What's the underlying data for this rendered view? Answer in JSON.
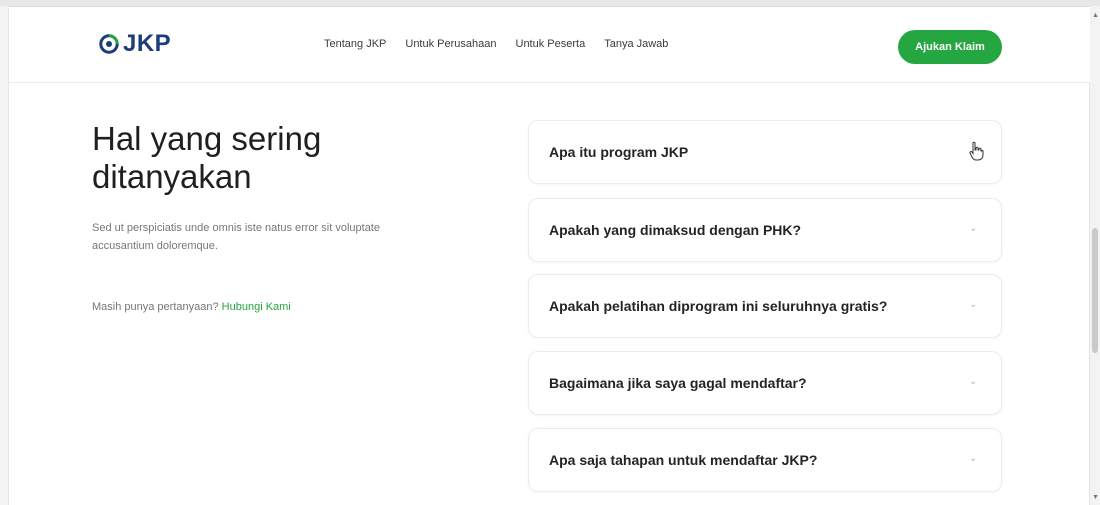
{
  "header": {
    "brand": "JKP",
    "nav": [
      "Tentang JKP",
      "Untuk Perusahaan",
      "Untuk Peserta",
      "Tanya Jawab"
    ],
    "cta_label": "Ajukan Klaim"
  },
  "faq": {
    "heading": "Hal yang sering ditanyakan",
    "description": "Sed ut perspiciatis unde omnis iste natus error sit voluptate accusantium doloremque.",
    "contact_prompt": "Masih punya pertanyaan?",
    "contact_link": "Hubungi Kami",
    "items": [
      {
        "question": "Apa itu program JKP"
      },
      {
        "question": "Apakah yang dimaksud dengan PHK?"
      },
      {
        "question": "Apakah pelatihan diprogram ini seluruhnya gratis?"
      },
      {
        "question": "Bagaimana jika saya gagal mendaftar?"
      },
      {
        "question": "Apa saja tahapan untuk mendaftar JKP?"
      }
    ]
  },
  "colors": {
    "brand": "#1d3c7a",
    "accent": "#25a641"
  },
  "icons": {
    "chevron": "chevron-down-icon",
    "cursor": "hand-pointer-icon"
  }
}
